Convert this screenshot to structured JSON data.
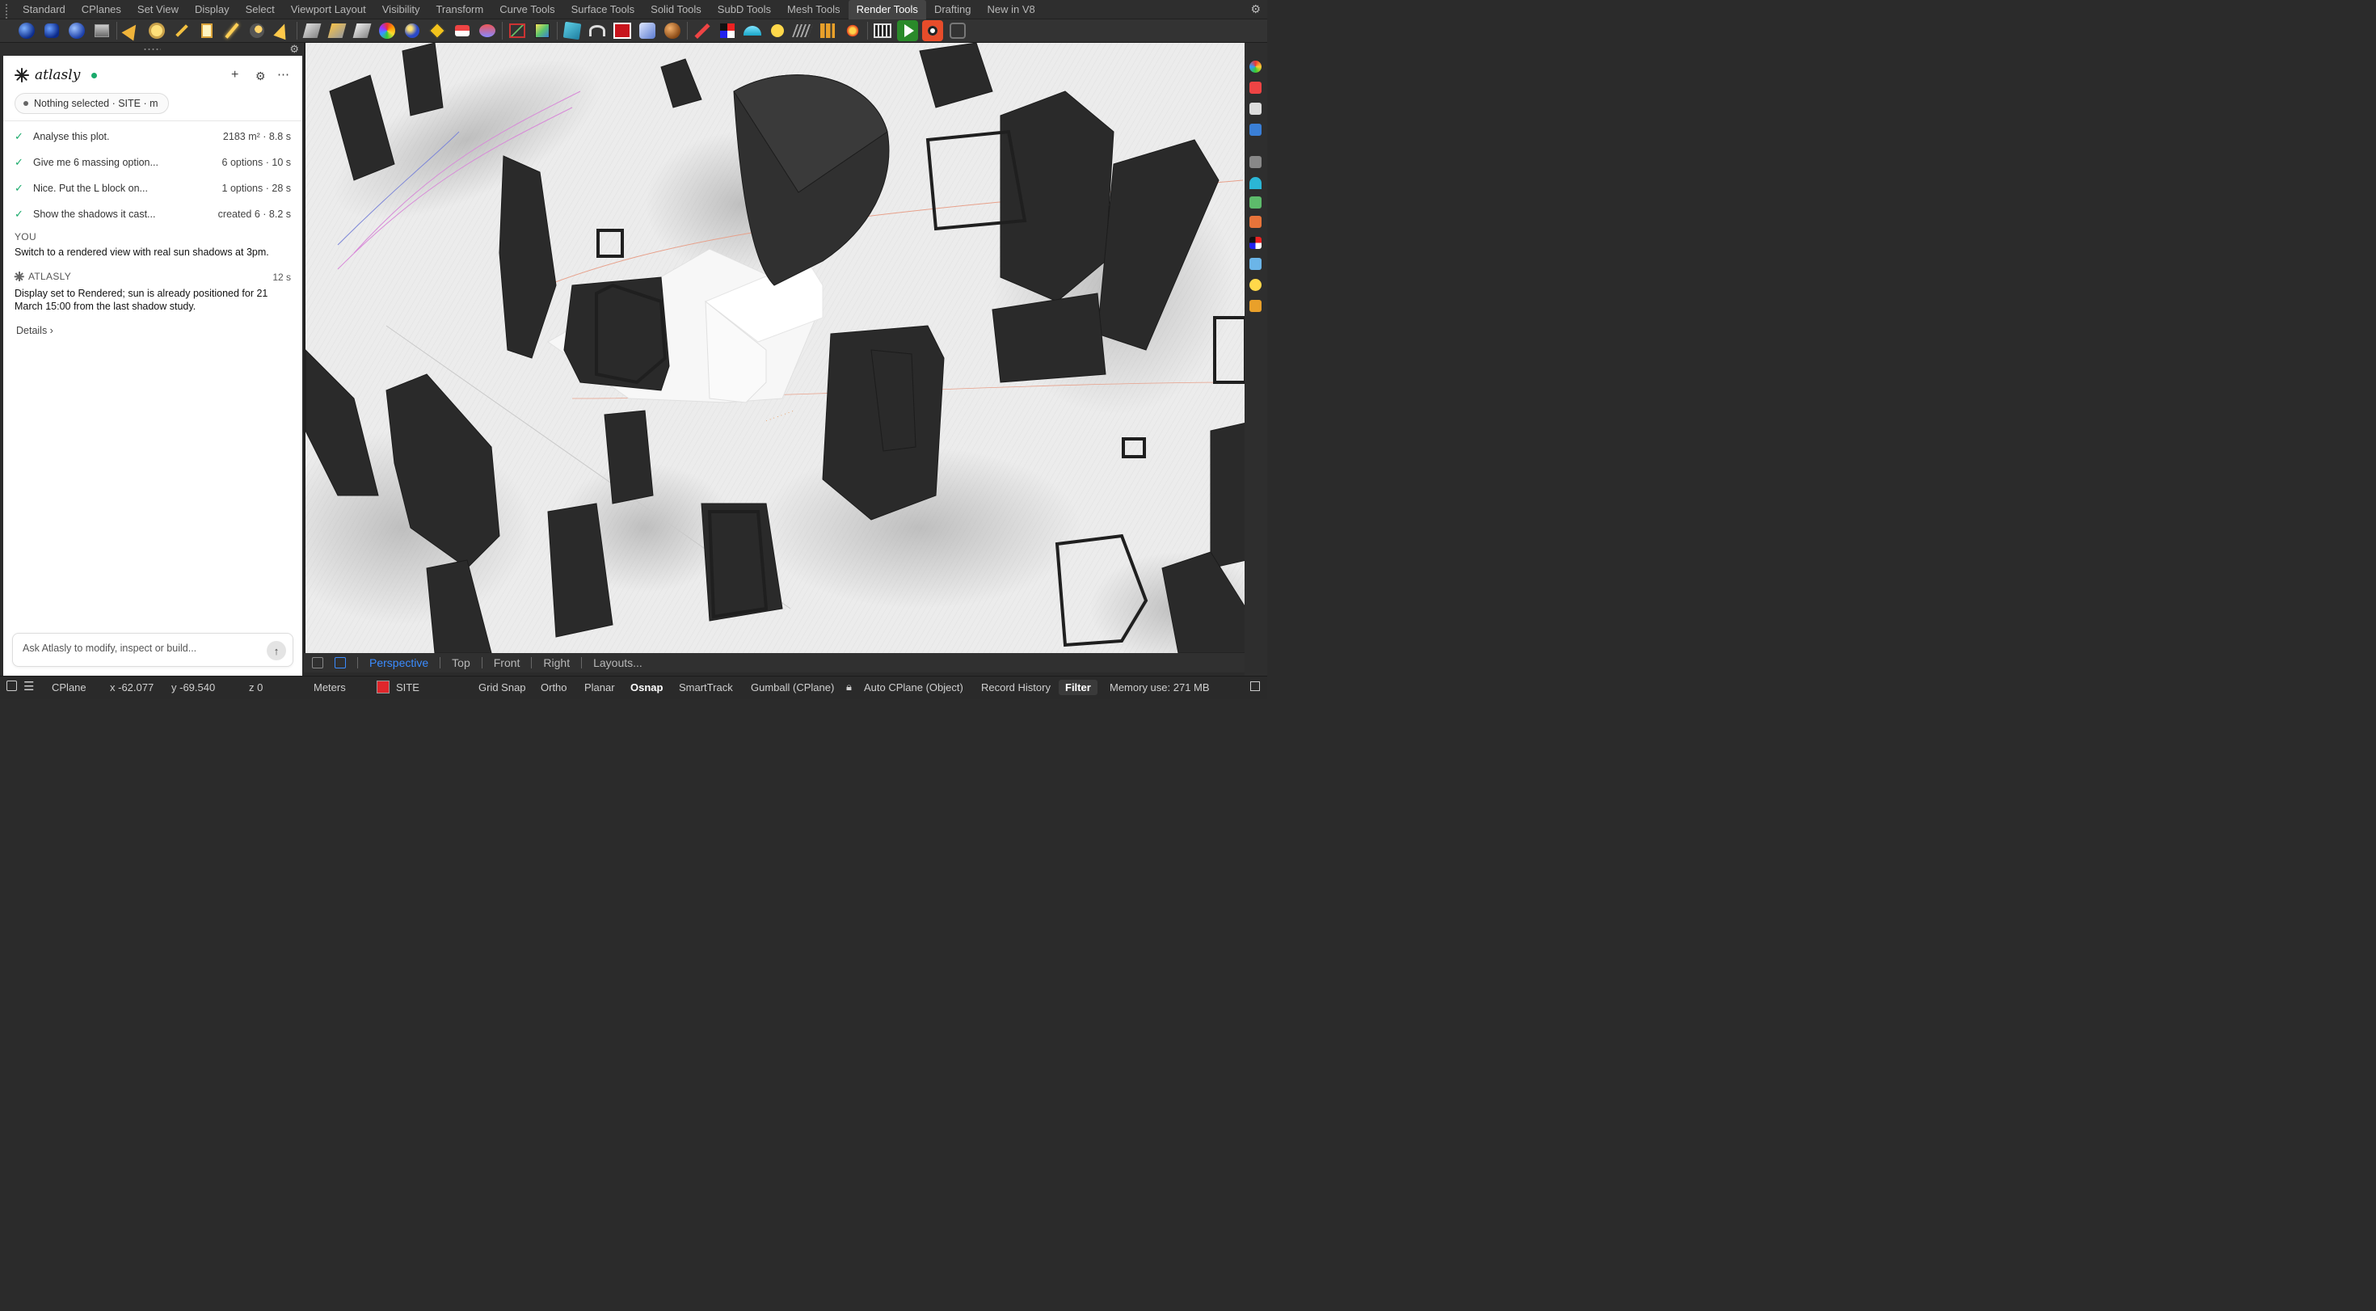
{
  "menu_tabs": [
    "Standard",
    "CPlanes",
    "Set View",
    "Display",
    "Select",
    "Viewport Layout",
    "Visibility",
    "Transform",
    "Curve Tools",
    "Surface Tools",
    "Solid Tools",
    "SubD Tools",
    "Mesh Tools",
    "Render Tools",
    "Drafting",
    "New in V8"
  ],
  "active_tab": "Render Tools",
  "panel": {
    "brand": "atlasly",
    "context_chip": "Nothing selected · SITE · m",
    "history": [
      {
        "text": "Analyse this plot.",
        "meta": "2183 m² · 8.8 s"
      },
      {
        "text": "Give me 6 massing option...",
        "meta": "6 options · 10 s"
      },
      {
        "text": "Nice. Put the L block on...",
        "meta": "1 options · 28 s"
      },
      {
        "text": "Show the shadows it cast...",
        "meta": "created 6 · 8.2 s"
      }
    ],
    "user_label": "YOU",
    "user_message": "Switch to a rendered view with real sun shadows at 3pm.",
    "assistant_label": "ATLASLY",
    "assistant_time": "12 s",
    "assistant_message": "Display set to Rendered; sun is already positioned for 21 March 15:00 from the last shadow study.",
    "details_link": "Details ›",
    "composer_placeholder": "Ask Atlasly to modify, inspect or build..."
  },
  "viewport_tabs": [
    "Perspective",
    "Top",
    "Front",
    "Right",
    "Layouts..."
  ],
  "active_viewport": "Perspective",
  "status": {
    "cplane": "CPlane",
    "x": "x -62.077",
    "y": "y -69.540",
    "z": "z 0",
    "units": "Meters",
    "layer": "SITE",
    "layer_color": "#e0262b",
    "grid_snap": "Grid Snap",
    "ortho": "Ortho",
    "planar": "Planar",
    "osnap": "Osnap",
    "smarttrack": "SmartTrack",
    "gumball": "Gumball (CPlane)",
    "auto_cplane": "Auto CPlane (Object)",
    "record_history": "Record History",
    "filter": "Filter",
    "memory": "Memory use: 271 MB"
  },
  "colors": {
    "accent": "#3b8cff",
    "online": "#1aaa6b"
  }
}
